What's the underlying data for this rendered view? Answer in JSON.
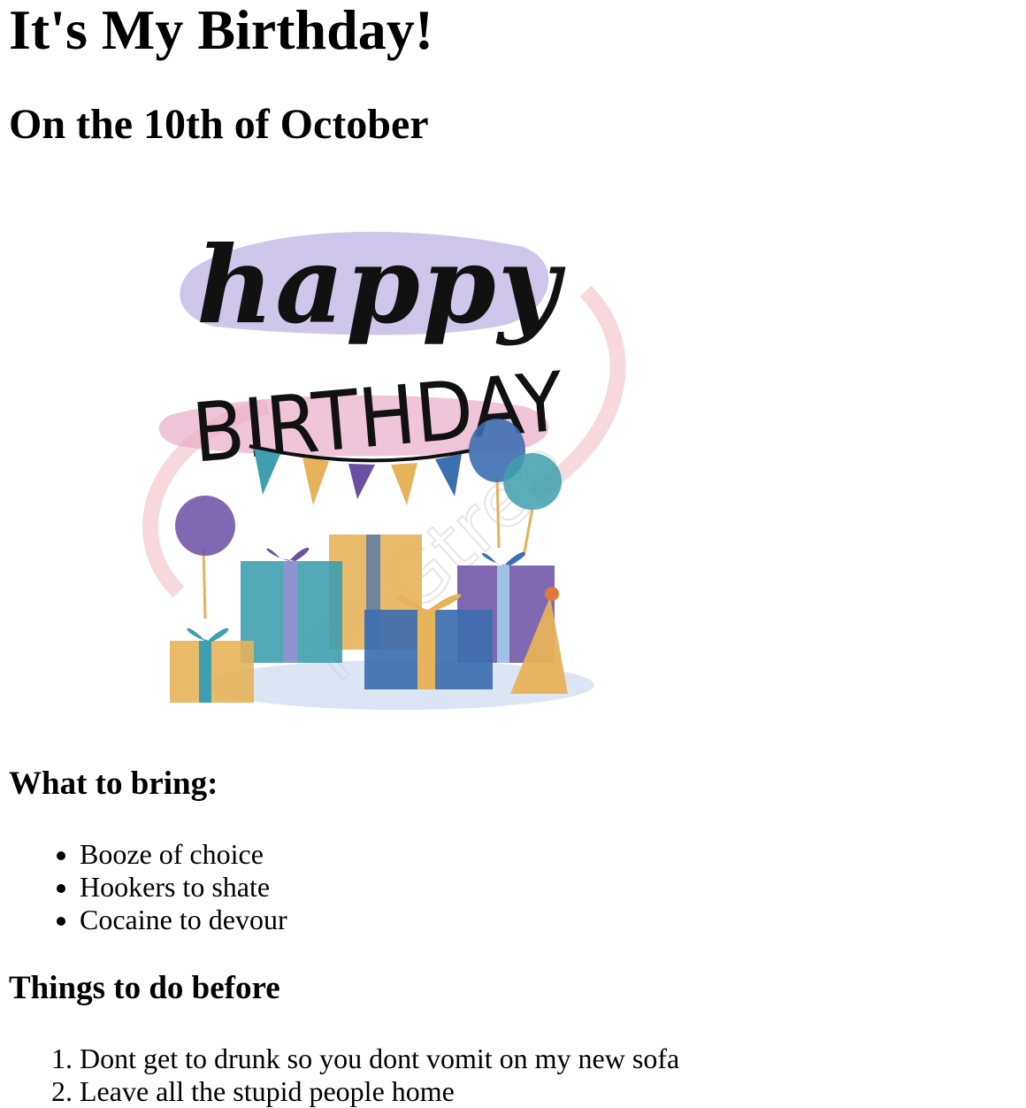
{
  "page": {
    "title": "It's My Birthday!",
    "subtitle": "On the 10th of October"
  },
  "image": {
    "script_line": "happy",
    "caption": "BIRTHDAY",
    "watermark": "PNGtree",
    "colors": {
      "lavender": "#b5a7e0",
      "pink": "#e9a6c4",
      "teal": "#3f9fae",
      "blue": "#3d6fb0",
      "purple": "#6a4fa3",
      "gold": "#e6b25a"
    }
  },
  "bring": {
    "heading": "What to bring:",
    "items": [
      "Booze of choice",
      "Hookers to shate",
      "Cocaine to devour"
    ]
  },
  "before": {
    "heading": "Things to do before",
    "items": [
      "Dont get to drunk so you dont vomit on my new sofa",
      "Leave all the stupid people home"
    ]
  }
}
